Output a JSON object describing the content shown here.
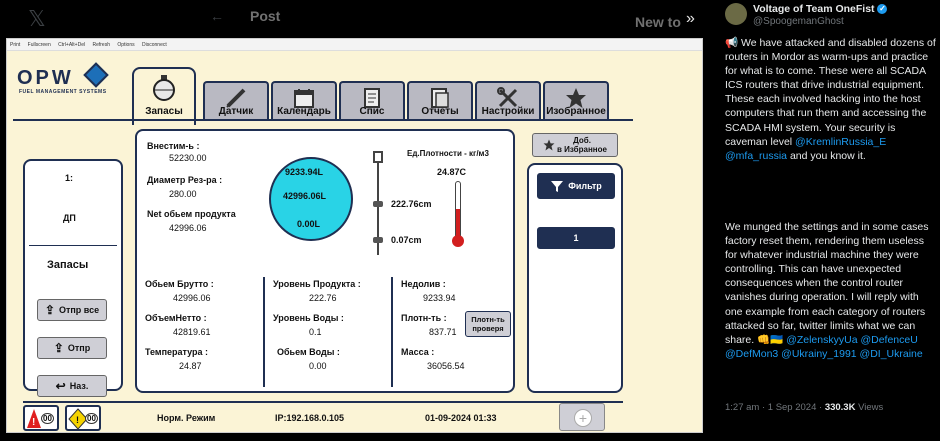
{
  "twitter": {
    "post_label": "Post",
    "new_label": "New to",
    "author_name": "Voltage of Team OneFist",
    "author_handle": "@SpoogemanGhost",
    "para1": "📢 We have attacked and disabled dozens of routers in Mordor as warm-ups and practice for what is to come. These were all SCADA ICS routers that drive industrial equipment. These each involved hacking into the host computers that run them and accessing the SCADA HMI system. Your security is caveman level",
    "mention1": "@KremlinRussia_E",
    "mention2": "@mfa_russia",
    "para1_end": "and you know it.",
    "para2": "We munged the settings and in some cases factory reset them, rendering them useless for whatever industrial machine they were controlling. This can have unexpected consequences when the control router vanishes during operation. I will reply with one example from each category of routers attacked so far, twitter limits what we can share.",
    "tail_emoji": "👊🇺🇦",
    "mentions_tail": "@ZelenskyyUa @DefenceU @DefMon3 @Ukrainy_1991 @DI_Ukraine",
    "time": "1:27 am · 1 Sep 2024 ·",
    "views_count": "330.3K",
    "views_label": "Views"
  },
  "browser_toolbar": [
    "Print",
    "Fullscreen",
    "Ctrl+Alt+Del",
    "Refresh",
    "Options",
    "Disconnect"
  ],
  "hmi": {
    "logo": "OPW",
    "logo_sub": "FUEL MANAGEMENT SYSTEMS",
    "tabs": [
      {
        "label": "Запасы",
        "icon": "tank-icon",
        "active": true
      },
      {
        "label": "Датчик",
        "icon": "probe-icon"
      },
      {
        "label": "Календарь",
        "icon": "calendar-icon"
      },
      {
        "label": "Спис",
        "icon": "list-icon"
      },
      {
        "label": "Отчеты",
        "icon": "report-icon"
      },
      {
        "label": "Настройки",
        "icon": "tools-icon"
      },
      {
        "label": "Изобранное",
        "icon": "star-icon"
      }
    ],
    "fav_button_line1": "Доб.",
    "fav_button_line2": "в Избранное",
    "left": {
      "number": "1:",
      "code": "ДП",
      "title": "Запасы",
      "btn_export_all": "Отпр все",
      "btn_export": "Отпр",
      "btn_back": "Наз."
    },
    "main": {
      "intake_label": "Внестим-ь :",
      "intake_value": "52230.00",
      "diameter_label": "Диаметр Рез-ра :",
      "diameter_value": "280.00",
      "net_label": "Net обьем продукта",
      "net_value": "42996.06",
      "tank_vals": [
        "9233.94L",
        "42996.06L",
        "0.00L"
      ],
      "density_unit": "Ед.Плотности - кг/м3",
      "temp_reading": "24.87C",
      "level1": "222.76cm",
      "level2": "0.07cm",
      "gross_label": "Обьем Брутто :",
      "gross_value": "42996.06",
      "netto_label": "ОбъемНетто :",
      "netto_value": "42819.61",
      "temp_label": "Температура :",
      "temp_value": "24.87",
      "product_level_label": "Уровень Продукта :",
      "product_level_value": "222.76",
      "water_level_label": "Уровень Воды :",
      "water_level_value": "0.1",
      "water_volume_label": "Обьем Воды :",
      "water_volume_value": "0.00",
      "ullage_label": "Недолив :",
      "ullage_value": "9233.94",
      "density_label": "Плотн-ть :",
      "density_value": "837.71",
      "density_btn_line1": "Плотн-ть",
      "density_btn_line2": "проверя",
      "mass_label": "Масса :",
      "mass_value": "36056.54"
    },
    "right": {
      "filter": "Фильтр",
      "count": "1"
    },
    "status": {
      "alarm_count": "00",
      "warn_count": "00",
      "mode": "Норм. Режим",
      "ip": "IP:192.168.0.105",
      "datetime": "01-09-2024 01:33"
    },
    "colors": {
      "accent": "#1f2f52",
      "tank": "#29d3e6",
      "background": "#fbf4d6"
    }
  }
}
